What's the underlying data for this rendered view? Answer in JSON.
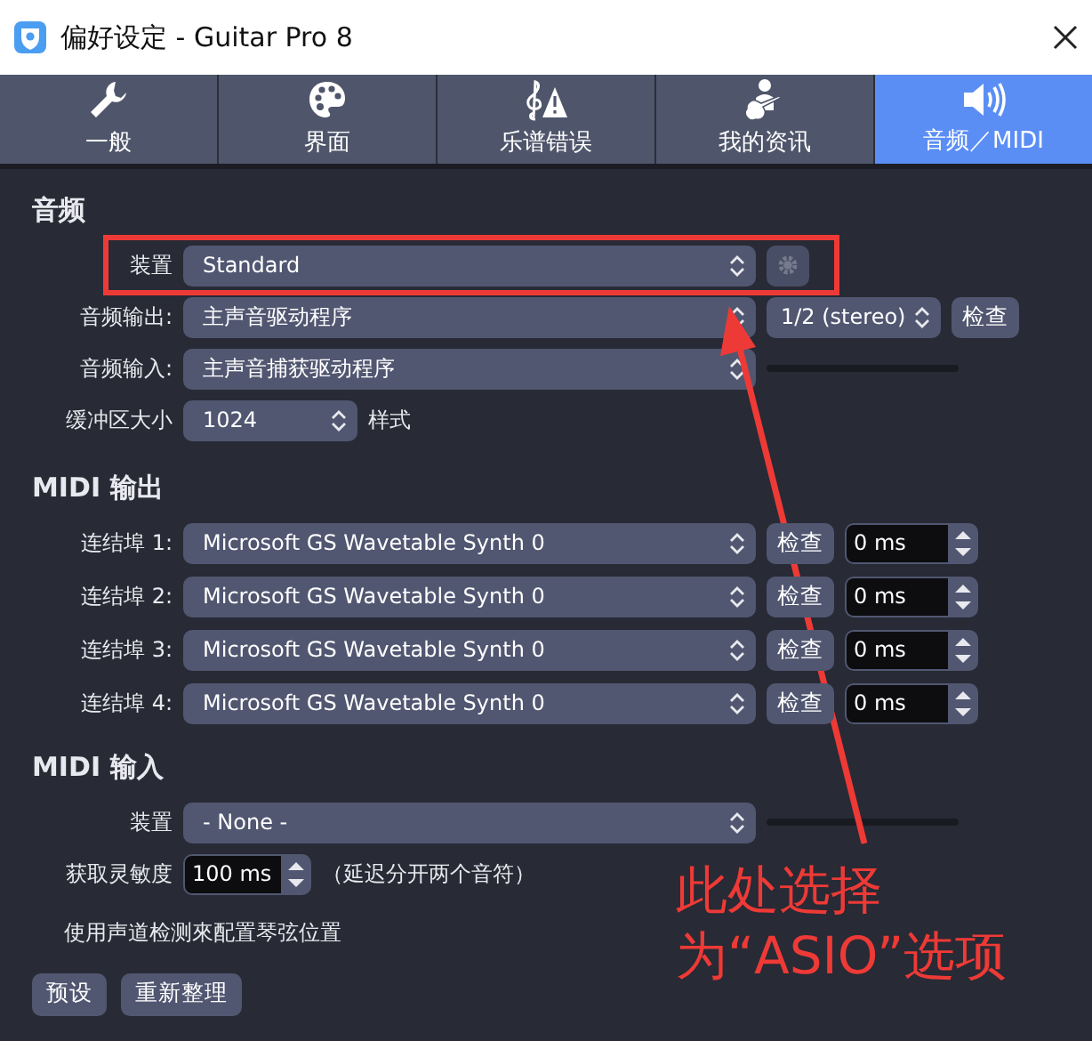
{
  "window": {
    "title": "偏好设定 - Guitar Pro 8"
  },
  "tabs": [
    {
      "label": "一般",
      "selected": false
    },
    {
      "label": "界面",
      "selected": false
    },
    {
      "label": "乐谱错误",
      "selected": false
    },
    {
      "label": "我的资讯",
      "selected": false
    },
    {
      "label": "音频／MIDI",
      "selected": true
    }
  ],
  "audio": {
    "heading": "音频",
    "device": {
      "label": "装置",
      "value": "Standard"
    },
    "output": {
      "label": "音频输出:",
      "value": "主声音驱动程序",
      "channels": "1/2 (stereo)",
      "test": "检查"
    },
    "input": {
      "label": "音频输入:",
      "value": "主声音捕获驱动程序"
    },
    "buffer": {
      "label": "缓冲区大小",
      "value": "1024",
      "style_label": "样式"
    }
  },
  "midi_output": {
    "heading": "MIDI 输出",
    "ports": [
      {
        "label": "连结埠 1:",
        "device": "Microsoft GS Wavetable Synth 0",
        "test": "检查",
        "delay": "0 ms"
      },
      {
        "label": "连结埠 2:",
        "device": "Microsoft GS Wavetable Synth 0",
        "test": "检查",
        "delay": "0 ms"
      },
      {
        "label": "连结埠 3:",
        "device": "Microsoft GS Wavetable Synth 0",
        "test": "检查",
        "delay": "0 ms"
      },
      {
        "label": "连结埠 4:",
        "device": "Microsoft GS Wavetable Synth 0",
        "test": "检查",
        "delay": "0 ms"
      }
    ]
  },
  "midi_input": {
    "heading": "MIDI 输入",
    "device": {
      "label": "装置",
      "value": "- None -"
    },
    "sensitivity": {
      "label": "获取灵敏度",
      "value": "100 ms",
      "note": "（延迟分开两个音符）"
    },
    "string_detection": "使用声道检测來配置琴弦位置"
  },
  "buttons": [
    "预设",
    "重新整理"
  ],
  "annotation": {
    "lines": [
      "此处选择",
      "为“ASIO”选项"
    ]
  }
}
